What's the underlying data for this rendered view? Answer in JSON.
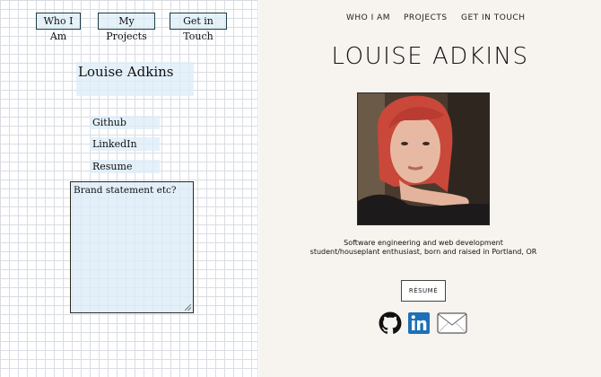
{
  "wireframe": {
    "nav": [
      "Who I Am",
      "My Projects",
      "Get in Touch"
    ],
    "name": "Louise Adkins",
    "links": [
      "Github",
      "LinkedIn",
      "Resume"
    ],
    "brand_placeholder": "Brand statement etc?"
  },
  "site": {
    "nav": [
      "WHO I AM",
      "PROJECTS",
      "GET IN TOUCH"
    ],
    "title": "LOUISE ADKINS",
    "bio": "Software engineering and web development student/houseplant enthusiast, born and raised in Portland, OR",
    "resume_button": "RÉSUMÉ",
    "icons": [
      "github-icon",
      "linkedin-icon",
      "email-icon"
    ],
    "colors": {
      "background": "#f7f3ee",
      "linkedin": "#1d6fb8",
      "hair": "#c9483a"
    }
  }
}
